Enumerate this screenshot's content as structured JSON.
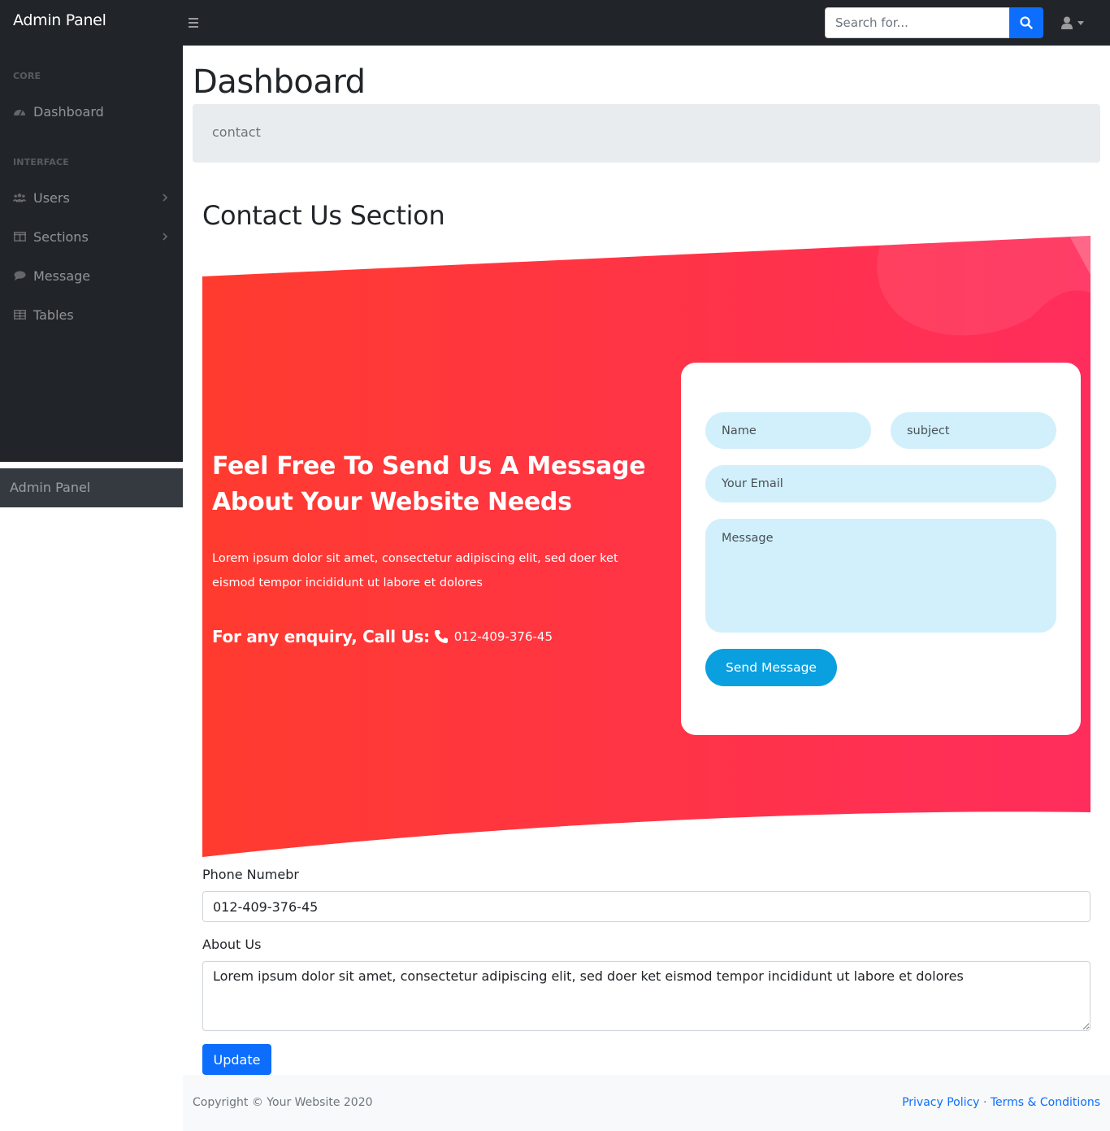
{
  "navbar": {
    "brand": "Admin Panel",
    "search_placeholder": "Search for...",
    "accent_color": "#0d6efd"
  },
  "sidebar": {
    "headings": {
      "core": "CORE",
      "interface": "INTERFACE"
    },
    "items": [
      {
        "label": "Dashboard",
        "icon": "dashboard-gauge-icon"
      },
      {
        "label": "Users",
        "icon": "users-icon",
        "has_submenu": true
      },
      {
        "label": "Sections",
        "icon": "columns-icon",
        "has_submenu": true
      },
      {
        "label": "Message",
        "icon": "comment-icon"
      },
      {
        "label": "Tables",
        "icon": "table-icon"
      }
    ],
    "footer": "Admin Panel"
  },
  "page": {
    "title": "Dashboard",
    "breadcrumb": "contact",
    "section_title": "Contact Us Section"
  },
  "hero": {
    "headline": "Feel Free To Send Us A Message About Your Website Needs",
    "text": "Lorem ipsum dolor sit amet, consectetur adipiscing elit, sed doer ket eismod tempor incididunt ut labore et dolores",
    "call_label": "For any enquiry, Call Us:",
    "phone": "012-409-376-45",
    "gradient": [
      "#ff3b2f",
      "#ff2d5c"
    ]
  },
  "contact_form": {
    "name_placeholder": "Name",
    "subject_placeholder": "subject",
    "email_placeholder": "Your Email",
    "message_placeholder": "Message",
    "send_label": "Send Message",
    "field_color": "#d1f0fb",
    "button_color": "#0aa0e0"
  },
  "edit_form": {
    "phone_label": "Phone Numebr",
    "phone_value": "012-409-376-45",
    "about_label": "About Us",
    "about_value": "Lorem ipsum dolor sit amet, consectetur adipiscing elit, sed doer ket eismod tempor incididunt ut labore et dolores",
    "update_label": "Update"
  },
  "footer": {
    "copyright": "Copyright © Your Website 2020",
    "privacy": "Privacy Policy",
    "separator": "·",
    "terms": "Terms & Conditions"
  }
}
